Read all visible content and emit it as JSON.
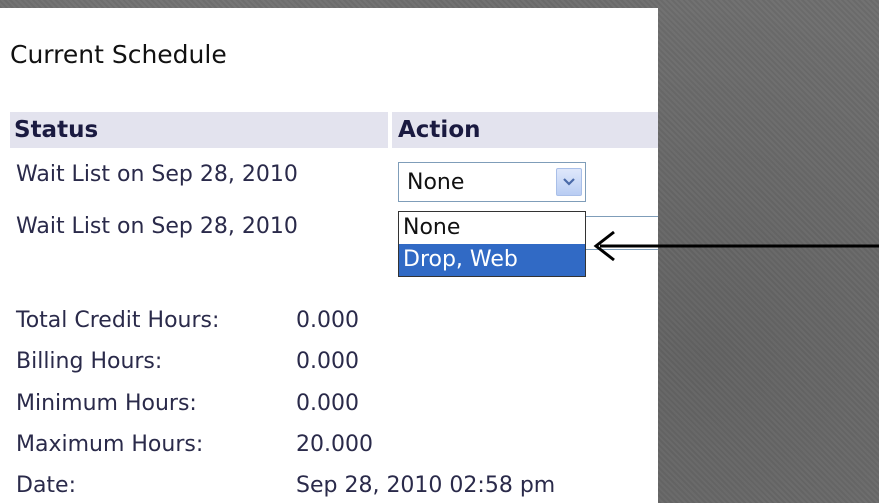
{
  "title": "Current Schedule",
  "table": {
    "headers": {
      "status": "Status",
      "action": "Action"
    },
    "rows": [
      {
        "status": "Wait List on Sep 28, 2010",
        "action_value": "None"
      },
      {
        "status": "Wait List on Sep 28, 2010"
      }
    ]
  },
  "dropdown": {
    "options": [
      "None",
      "Drop, Web"
    ],
    "highlighted": "Drop, Web"
  },
  "summary": [
    {
      "label": "Total Credit Hours:",
      "value": "0.000"
    },
    {
      "label": "Billing Hours:",
      "value": "0.000"
    },
    {
      "label": "Minimum Hours:",
      "value": "0.000"
    },
    {
      "label": "Maximum Hours:",
      "value": "20.000"
    },
    {
      "label": "Date:",
      "value": "Sep 28, 2010 02:58 pm"
    }
  ],
  "colors": {
    "header_bg": "#e3e3ee",
    "selected_option_bg": "#316ac5",
    "background": "#6d6d6d"
  },
  "icons": {
    "select_button": "chevron-down-icon",
    "annotation": "arrow-left-icon"
  }
}
